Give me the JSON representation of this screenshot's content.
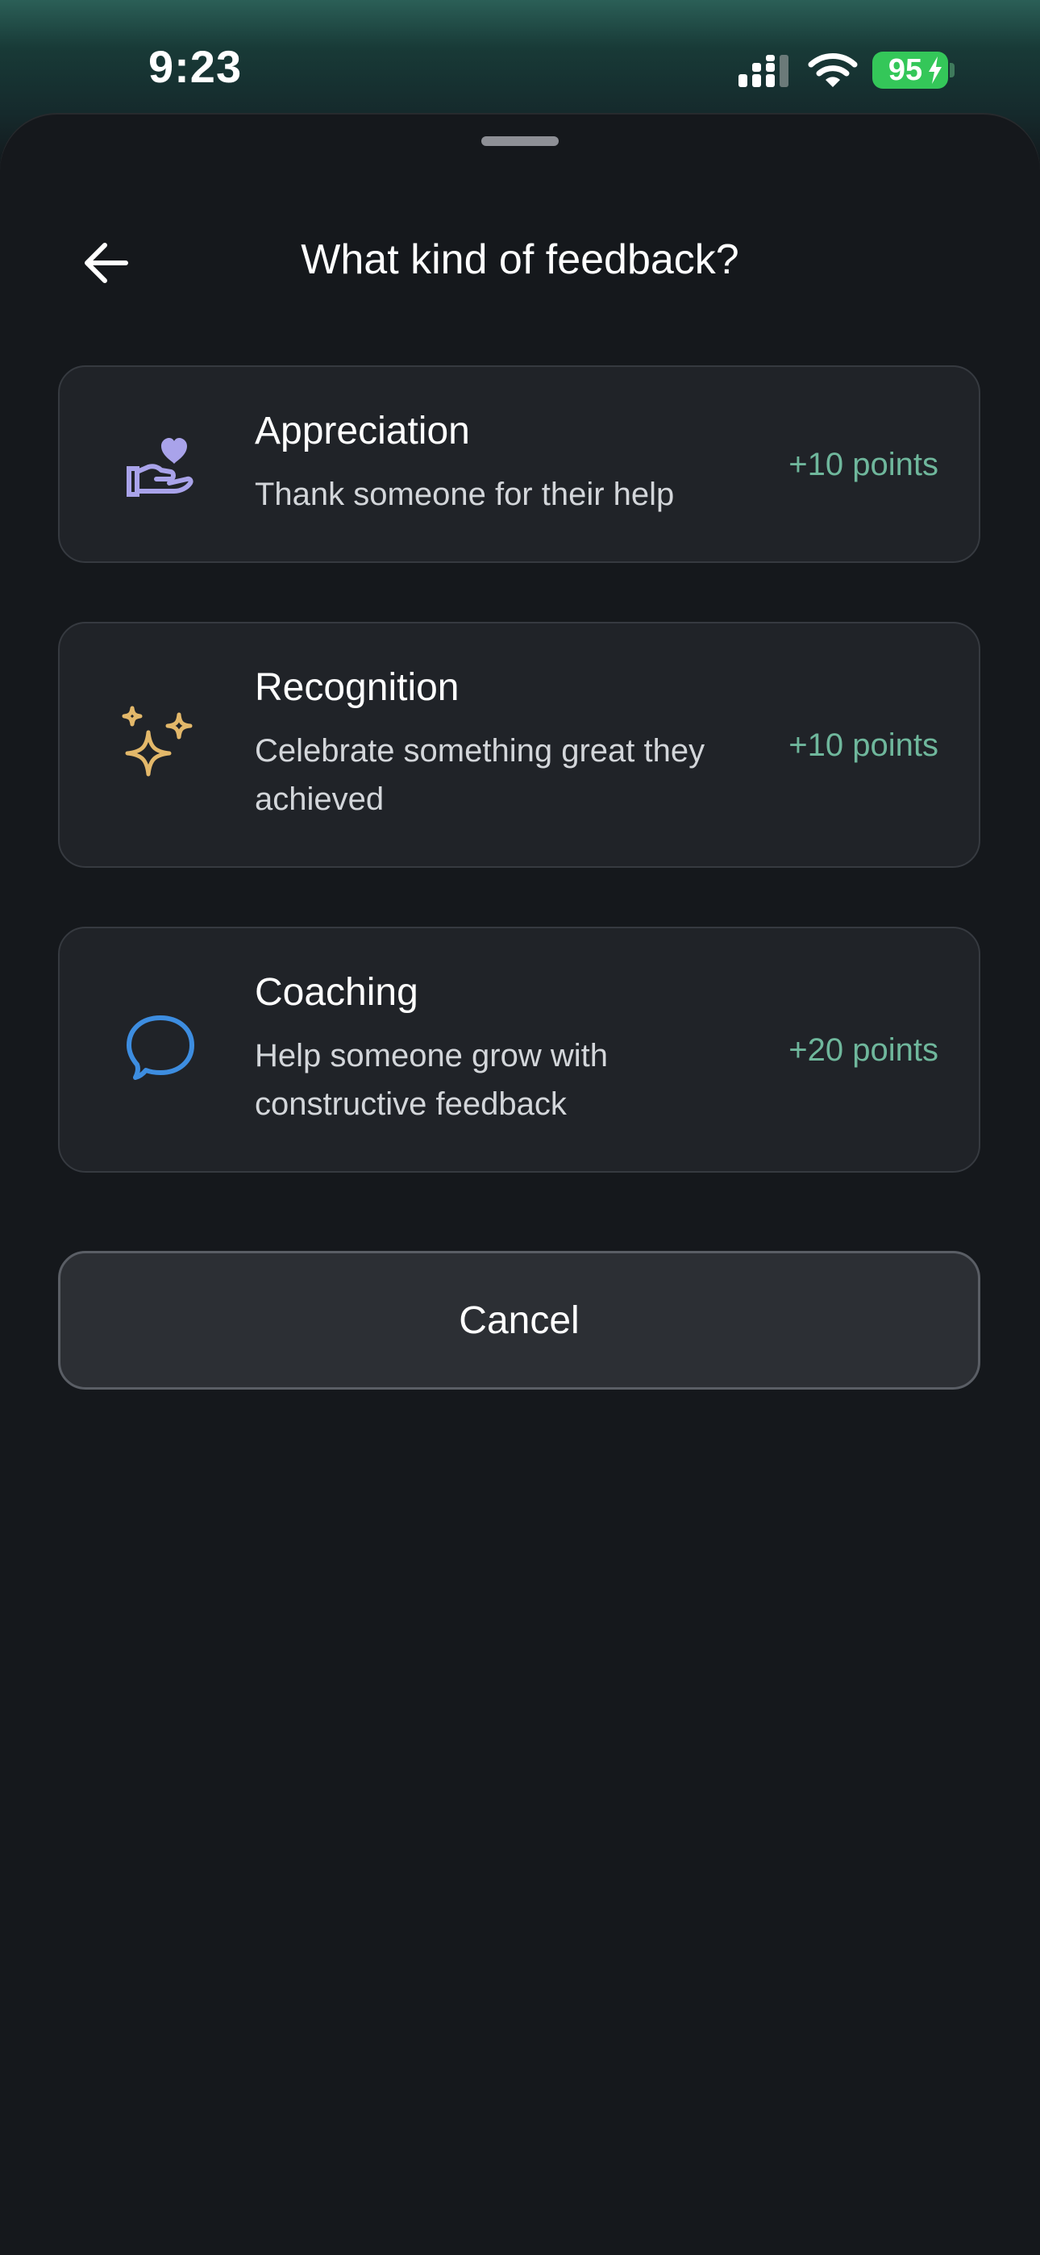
{
  "status_bar": {
    "time": "9:23",
    "battery_level": "95",
    "icons": [
      "signal-icon",
      "wifi-icon",
      "battery-icon",
      "charging-bolt-icon"
    ]
  },
  "sheet": {
    "title": "What kind of feedback?",
    "back_icon": "arrow-left-icon"
  },
  "options": [
    {
      "icon": "hand-heart-icon",
      "icon_color": "#a9a3ea",
      "title": "Appreciation",
      "description": "Thank someone for their help",
      "points": "+10 points"
    },
    {
      "icon": "sparkles-icon",
      "icon_color": "#e3b86a",
      "title": "Recognition",
      "description": "Celebrate something great they achieved",
      "points": "+10 points"
    },
    {
      "icon": "chat-bubble-icon",
      "icon_color": "#3d8de0",
      "title": "Coaching",
      "description": "Help someone grow with constructive feedback",
      "points": "+20 points"
    }
  ],
  "cancel_label": "Cancel",
  "colors": {
    "background": "#15181c",
    "card": "#202328",
    "points": "#6fb79c",
    "battery": "#34c759"
  }
}
